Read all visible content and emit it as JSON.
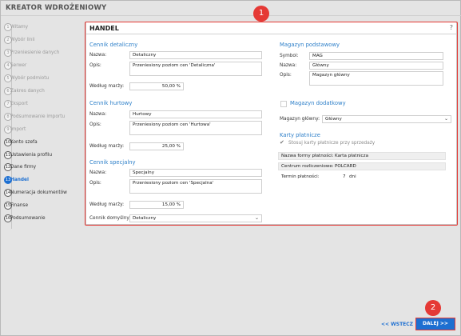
{
  "app": {
    "title": "KREATOR WDROŻENIOWY"
  },
  "steps": [
    {
      "num": "1",
      "label": "Witamy",
      "state": "done"
    },
    {
      "num": "2",
      "label": "Wybór linii",
      "state": "done"
    },
    {
      "num": "3",
      "label": "Przeniesienie danych",
      "state": "done"
    },
    {
      "num": "4",
      "label": "Serwer",
      "state": "done"
    },
    {
      "num": "5",
      "label": "Wybór podmiotu",
      "state": "done"
    },
    {
      "num": "6",
      "label": "Zakres danych",
      "state": "done"
    },
    {
      "num": "7",
      "label": "Eksport",
      "state": "done"
    },
    {
      "num": "8",
      "label": "Podsumowanie importu",
      "state": "done"
    },
    {
      "num": "9",
      "label": "Import",
      "state": "done"
    },
    {
      "num": "10",
      "label": "Konto szefa",
      "state": "todo"
    },
    {
      "num": "11",
      "label": "Ustawienia profilu",
      "state": "todo"
    },
    {
      "num": "12",
      "label": "Dane firmy",
      "state": "todo"
    },
    {
      "num": "13",
      "label": "Handel",
      "state": "active"
    },
    {
      "num": "14",
      "label": "Numeracja dokumentów",
      "state": "todo"
    },
    {
      "num": "15",
      "label": "Finanse",
      "state": "todo"
    },
    {
      "num": "16",
      "label": "Podsumowanie",
      "state": "todo"
    }
  ],
  "panel": {
    "title": "HANDEL",
    "help": "?"
  },
  "cennik_detaliczny": {
    "heading": "Cennik detaliczny",
    "name_label": "Nazwa:",
    "name_value": "Detaliczny",
    "desc_label": "Opis:",
    "desc_value": "Przeniesiony poziom cen 'Detaliczna'",
    "margin_label": "Według marży:",
    "margin_value": "50,00 %"
  },
  "cennik_hurtowy": {
    "heading": "Cennik hurtowy",
    "name_label": "Nazwa:",
    "name_value": "Hurtowy",
    "desc_label": "Opis:",
    "desc_value": "Przeniesiony poziom cen 'Hurtowa'",
    "margin_label": "Według marży:",
    "margin_value": "25,00 %"
  },
  "cennik_specjalny": {
    "heading": "Cennik specjalny",
    "name_label": "Nazwa:",
    "name_value": "Specjalny",
    "desc_label": "Opis:",
    "desc_value": "Przeniesiony poziom cen 'Specjalna'",
    "margin_label": "Według marży:",
    "margin_value": "15,00 %"
  },
  "default_price": {
    "label": "Cennik domyślny:",
    "value": "Detaliczny"
  },
  "magazyn_podstawowy": {
    "heading": "Magazyn podstawowy",
    "symbol_label": "Symbol:",
    "symbol_value": "MAG",
    "name_label": "Nazwa:",
    "name_value": "Główny",
    "desc_label": "Opis:",
    "desc_value": "Magazyn główny"
  },
  "magazyn_dodatkowy": {
    "label": "Magazyn dodatkowy",
    "main_label": "Magazyn główny:",
    "main_value": "Główny"
  },
  "karty": {
    "heading": "Karty płatnicze",
    "checkbox_label": "Stosuj karty płatnicze przy sprzedaży",
    "rows": [
      {
        "label": "Nazwa formy płatności:",
        "value": "Karta płatnicza"
      },
      {
        "label": "Centrum rozliczeniowe:",
        "value": "POLCARD"
      },
      {
        "label": "Termin płatności:",
        "value": "7",
        "unit": "dni"
      }
    ]
  },
  "callouts": [
    "1",
    "2"
  ],
  "nav": {
    "back_label": "<< WSTECZ",
    "next_label": "DALEJ >>"
  },
  "colors": {
    "accent": "#1d6fd1",
    "callout": "#e53935",
    "section": "#2f80c9"
  }
}
